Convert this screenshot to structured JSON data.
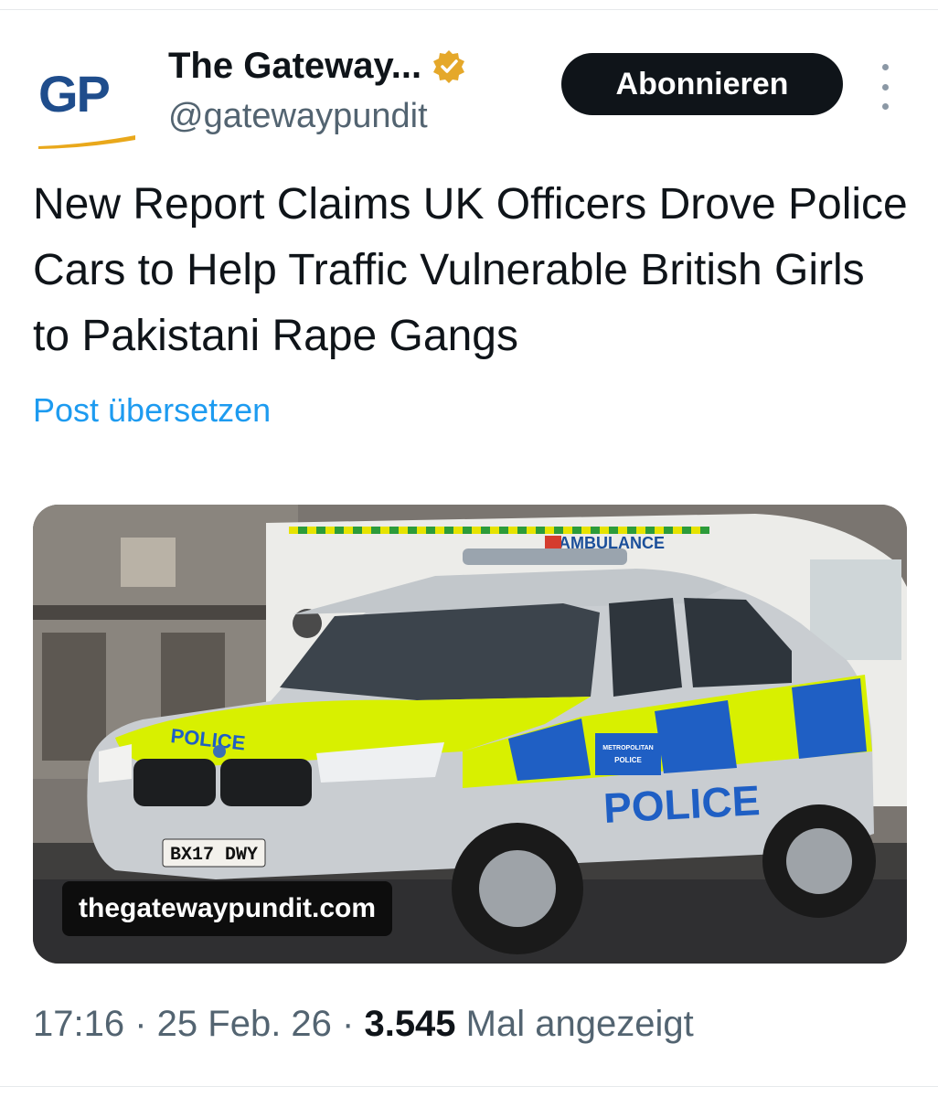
{
  "author": {
    "avatar_text": "GP",
    "display_name": "The Gateway...",
    "handle": "@gatewaypundit",
    "verified_badge": "gold-verified-icon"
  },
  "follow_button": {
    "label": "Abonnieren"
  },
  "post": {
    "text": "New Report Claims UK Officers Drove Police Cars to Help Traffic Vulnerable British Girls to Pakistani Rape Gangs",
    "translate_label": "Post übersetzen"
  },
  "media": {
    "domain": "thegatewaypundit.com",
    "image_text": {
      "car_hood": "POLICE",
      "car_side": "POLICE",
      "door_sign_line1": "METROPOLITAN",
      "door_sign_line2": "POLICE",
      "plate": "BX17 DWY",
      "ambulance": "AMBULANCE"
    }
  },
  "meta": {
    "time": "17:16",
    "separator": " · ",
    "date": "25 Feb. 26",
    "views_count": "3.545",
    "views_label": " Mal angezeigt"
  },
  "colors": {
    "link": "#1d9bf0",
    "button_bg": "#0f1419",
    "muted": "#536471",
    "police_yellow": "#d8f000",
    "police_blue": "#1f5fc4"
  }
}
